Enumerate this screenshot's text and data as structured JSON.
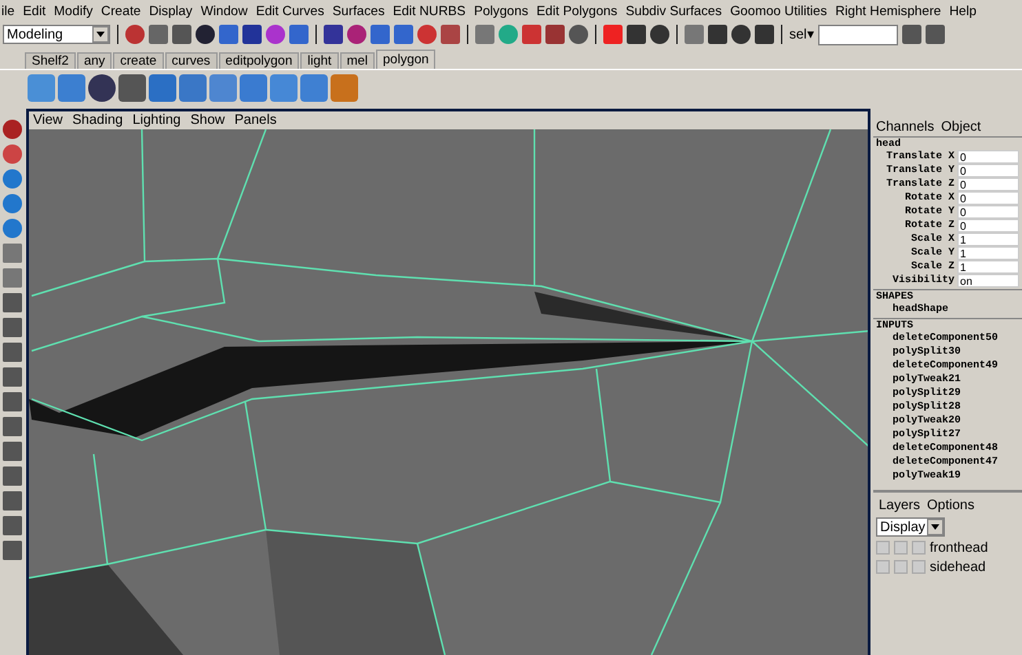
{
  "menu_bar": [
    "ile",
    "Edit",
    "Modify",
    "Create",
    "Display",
    "Window",
    "Edit Curves",
    "Surfaces",
    "Edit NURBS",
    "Polygons",
    "Edit Polygons",
    "Subdiv Surfaces",
    "Goomoo Utilities",
    "Right Hemisphere",
    "Help"
  ],
  "status_line": {
    "mode": "Modeling",
    "selection_label": "sel▾"
  },
  "shelf": {
    "tabs": [
      {
        "label": "Shelf2",
        "selected": false
      },
      {
        "label": "any",
        "selected": false
      },
      {
        "label": "create",
        "selected": false
      },
      {
        "label": "curves",
        "selected": false
      },
      {
        "label": "editpolygon",
        "selected": false
      },
      {
        "label": "light",
        "selected": false
      },
      {
        "label": "mel",
        "selected": false
      },
      {
        "label": "polygon",
        "selected": true
      }
    ]
  },
  "viewport": {
    "menu": [
      "View",
      "Shading",
      "Lighting",
      "Show",
      "Panels"
    ]
  },
  "channel_box": {
    "tabs": [
      "Channels",
      "Object"
    ],
    "node": "head",
    "attributes": [
      {
        "name": "Translate X",
        "value": "0"
      },
      {
        "name": "Translate Y",
        "value": "0"
      },
      {
        "name": "Translate Z",
        "value": "0"
      },
      {
        "name": "Rotate X",
        "value": "0"
      },
      {
        "name": "Rotate Y",
        "value": "0"
      },
      {
        "name": "Rotate Z",
        "value": "0"
      },
      {
        "name": "Scale X",
        "value": "1"
      },
      {
        "name": "Scale Y",
        "value": "1"
      },
      {
        "name": "Scale Z",
        "value": "1"
      },
      {
        "name": "Visibility",
        "value": "on"
      }
    ],
    "shapes_header": "SHAPES",
    "shapes": [
      "headShape"
    ],
    "inputs_header": "INPUTS",
    "inputs": [
      "deleteComponent50",
      "polySplit30",
      "deleteComponent49",
      "polyTweak21",
      "polySplit29",
      "polySplit28",
      "polyTweak20",
      "polySplit27",
      "deleteComponent48",
      "deleteComponent47",
      "polyTweak19"
    ]
  },
  "layer_editor": {
    "menu": [
      "Layers",
      "Options"
    ],
    "display": "Display",
    "layers": [
      {
        "name": "fronthead"
      },
      {
        "name": "sidehead"
      }
    ]
  }
}
